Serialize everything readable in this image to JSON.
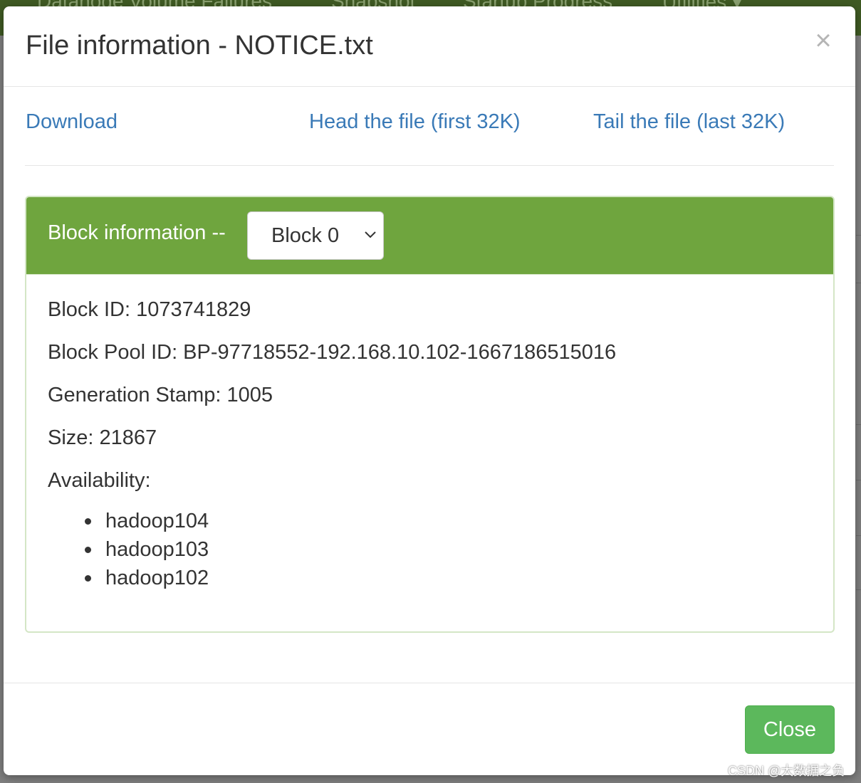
{
  "background": {
    "nav_items": [
      "Datanode Volume Failures",
      "Snapshot",
      "Startup Progress",
      "Utilities ▾"
    ]
  },
  "modal": {
    "title": "File information - NOTICE.txt",
    "close_icon": "×",
    "links": {
      "download": "Download",
      "head": "Head the file (first 32K)",
      "tail": "Tail the file (last 32K)"
    },
    "panel": {
      "heading": "Block information --",
      "select_value": "Block 0",
      "block_id": "Block ID: 1073741829",
      "block_pool_id": "Block Pool ID: BP-97718552-192.168.10.102-1667186515016",
      "generation_stamp": "Generation Stamp: 1005",
      "size": "Size: 21867",
      "availability_label": "Availability:",
      "hosts": [
        "hadoop104",
        "hadoop103",
        "hadoop102"
      ]
    },
    "footer": {
      "close_label": "Close"
    }
  },
  "colors": {
    "panel_header": "#6fa53e",
    "link": "#3a7ab7",
    "close_button": "#5cb85c",
    "overlay": "#7f7f7f"
  },
  "watermark": "CSDN @大数据之负"
}
